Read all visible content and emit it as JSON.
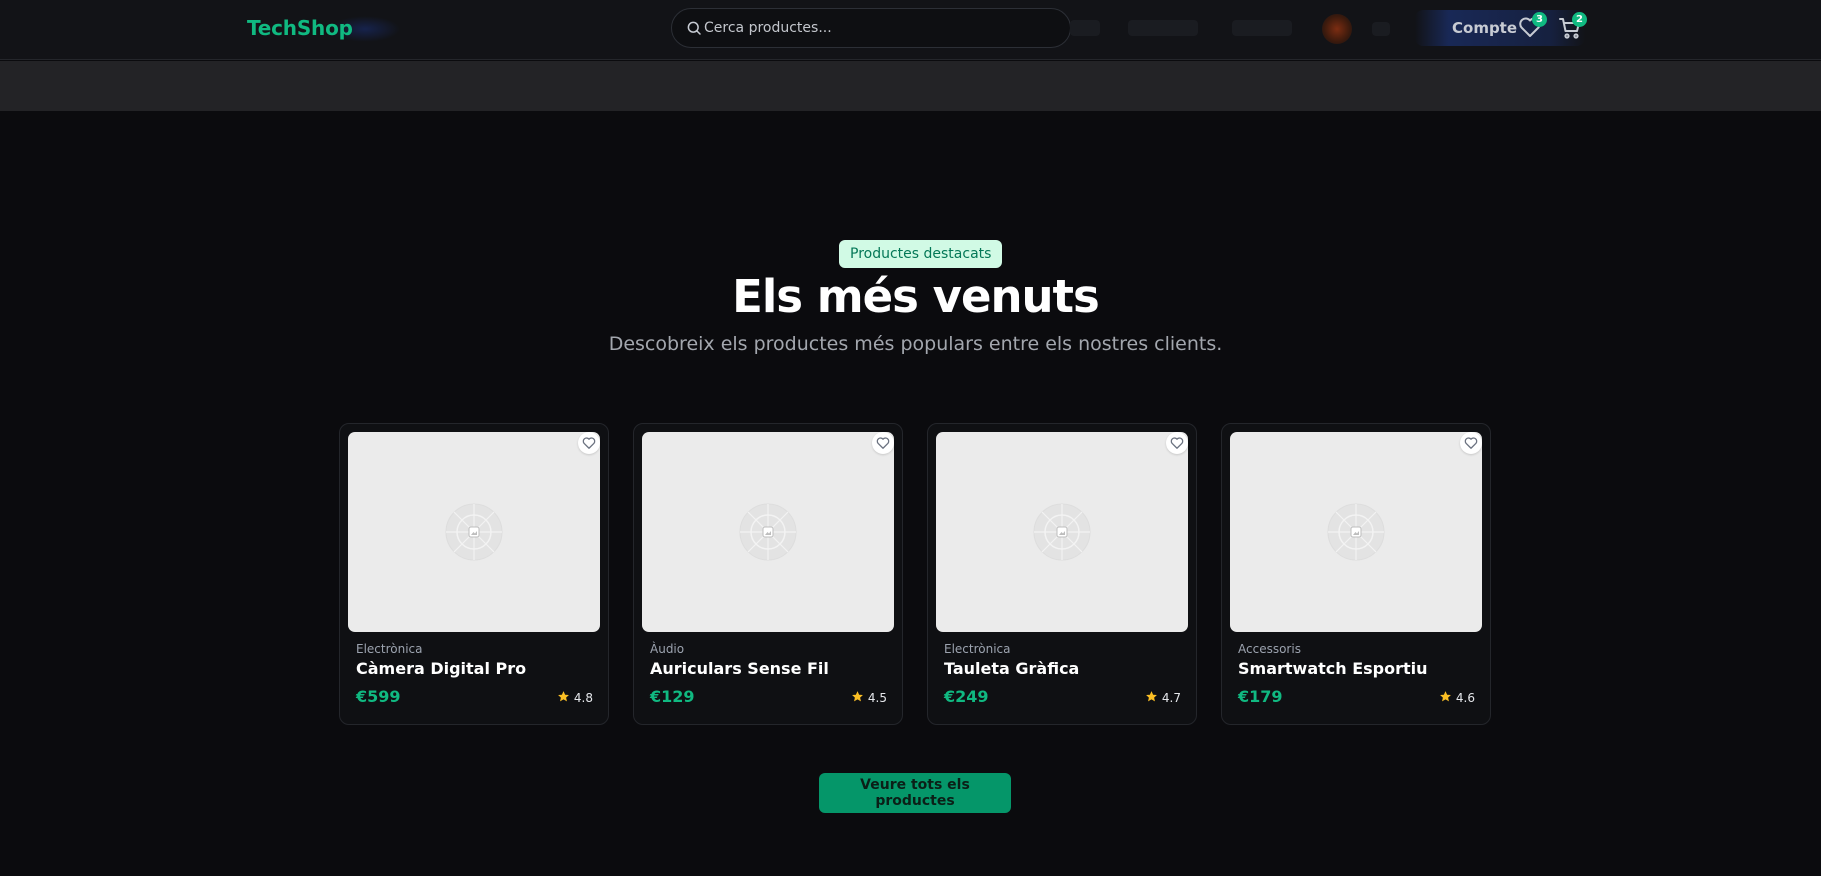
{
  "brand": {
    "name": "TechShop",
    "accent_color": "#10b981"
  },
  "search": {
    "placeholder": "Cerca productes...",
    "value": ""
  },
  "header": {
    "account_label": "Compte",
    "wishlist_count": "3",
    "cart_count": "2"
  },
  "section": {
    "badge": "Productes destacats",
    "title": "Els més venuts",
    "subtitle": "Descobreix els productes més populars entre els nostres clients."
  },
  "products": [
    {
      "category": "Electrònica",
      "name": "Càmera Digital Pro",
      "price": "€599",
      "rating": "4.8"
    },
    {
      "category": "Àudio",
      "name": "Auriculars Sense Fil",
      "price": "€129",
      "rating": "4.5"
    },
    {
      "category": "Electrònica",
      "name": "Tauleta Gràfica",
      "price": "€249",
      "rating": "4.7"
    },
    {
      "category": "Accessoris",
      "name": "Smartwatch Esportiu",
      "price": "€179",
      "rating": "4.6"
    }
  ],
  "cta": {
    "label": "Veure tots els productes"
  },
  "icons": {
    "search": "search-icon",
    "wishlist": "heart-icon",
    "cart": "cart-icon",
    "favorite": "heart-outline-icon",
    "rating": "star-icon",
    "image_placeholder": "image-placeholder-icon"
  },
  "colors": {
    "background": "#0b0b0e",
    "header": "#121317",
    "price": "#10b981",
    "star": "#fbbf24",
    "cta": "#059669",
    "badge_bg": "#d1fae5",
    "badge_text": "#047857"
  }
}
